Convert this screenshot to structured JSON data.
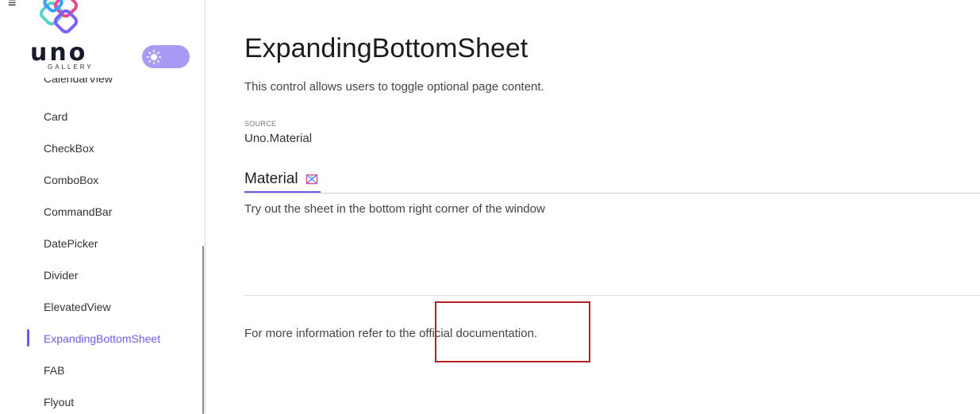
{
  "sidebar": {
    "logo_text": "uno",
    "logo_subtext": "GALLERY",
    "items": [
      {
        "label": "CalendarView"
      },
      {
        "label": "Card"
      },
      {
        "label": "CheckBox"
      },
      {
        "label": "ComboBox"
      },
      {
        "label": "CommandBar"
      },
      {
        "label": "DatePicker"
      },
      {
        "label": "Divider"
      },
      {
        "label": "ElevatedView"
      },
      {
        "label": "ExpandingBottomSheet",
        "active": true
      },
      {
        "label": "FAB"
      },
      {
        "label": "Flyout"
      }
    ]
  },
  "page": {
    "title": "ExpandingBottomSheet",
    "description": "This control allows users to toggle optional page content.",
    "source_label": "SOURCE",
    "source_value": "Uno.Material",
    "tab_label": "Material",
    "tab_content": "Try out the sheet in the bottom right corner of the window",
    "info_prefix": "For more information refer to the ",
    "info_link": "official documentation."
  },
  "colors": {
    "accent": "#6c5ce7",
    "toggle_bg": "#a99bf5",
    "highlight_border": "#b22222"
  },
  "icons": {
    "menu": "hamburger-icon",
    "logo": "uno-logo-icon",
    "theme": "sun-icon",
    "material": "material-design-icon"
  }
}
